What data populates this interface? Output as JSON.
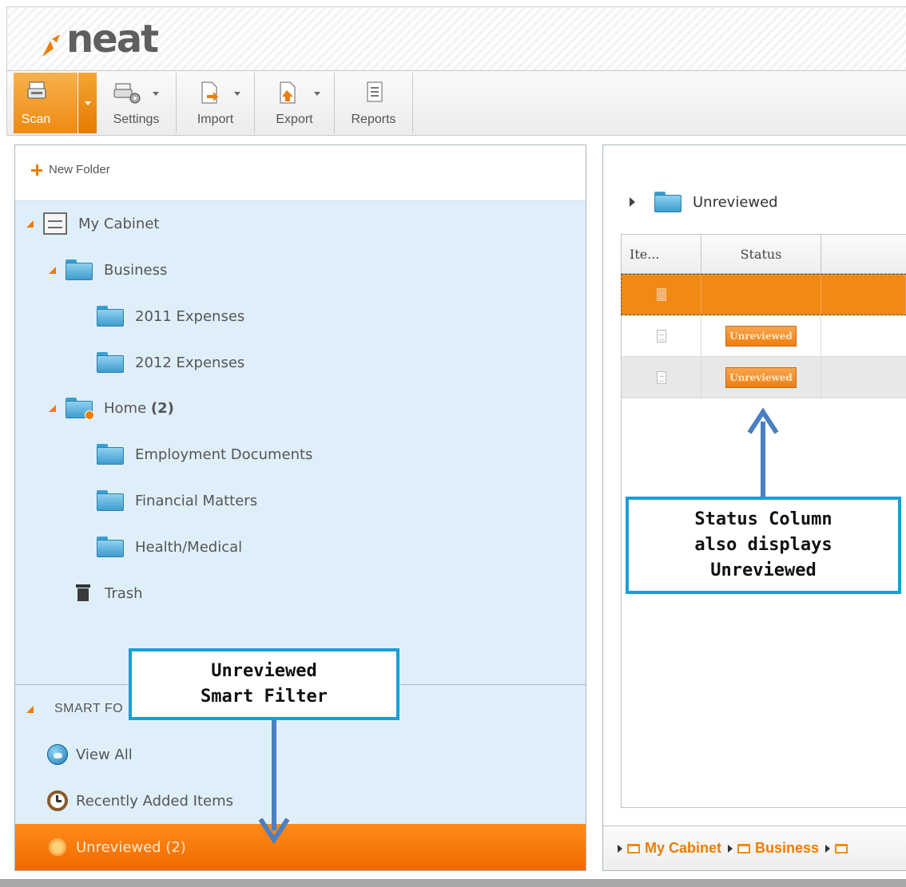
{
  "app": {
    "logo_text": "neat"
  },
  "toolbar": {
    "scan_label": "Scan",
    "settings_label": "Settings",
    "import_label": "Import",
    "export_label": "Export",
    "reports_label": "Reports"
  },
  "sidebar": {
    "new_folder_label": "New Folder",
    "tree": {
      "my_cabinet": "My Cabinet",
      "business": "Business",
      "expenses_2011": "2011 Expenses",
      "expenses_2012": "2012 Expenses",
      "home": "Home",
      "home_count": "(2)",
      "employment_documents": "Employment Documents",
      "financial_matters": "Financial Matters",
      "health_medical": "Health/Medical",
      "trash": "Trash"
    },
    "smart_folders_label": "SMART FO",
    "smart_items": {
      "view_all": "View All",
      "recently_added": "Recently Added Items",
      "unreviewed": "Unreviewed (2)"
    }
  },
  "main": {
    "folder_title": "Unreviewed",
    "columns": {
      "item": "Ite...",
      "status": "Status"
    },
    "rows": [
      {
        "status": ""
      },
      {
        "status": "Unreviewed"
      },
      {
        "status": "Unreviewed"
      }
    ],
    "breadcrumb": [
      "My Cabinet",
      "Business"
    ]
  },
  "callouts": {
    "status_column_line1": "Status Column",
    "status_column_line2": "also displays",
    "status_column_line3": "Unreviewed",
    "smart_filter_line1": "Unreviewed",
    "smart_filter_line2": "Smart Filter"
  },
  "colors": {
    "accent_orange": "#f07c00",
    "callout_blue": "#1a9ed8",
    "arrow_blue": "#4a7fc1",
    "panel_bg": "#dfeffa"
  }
}
